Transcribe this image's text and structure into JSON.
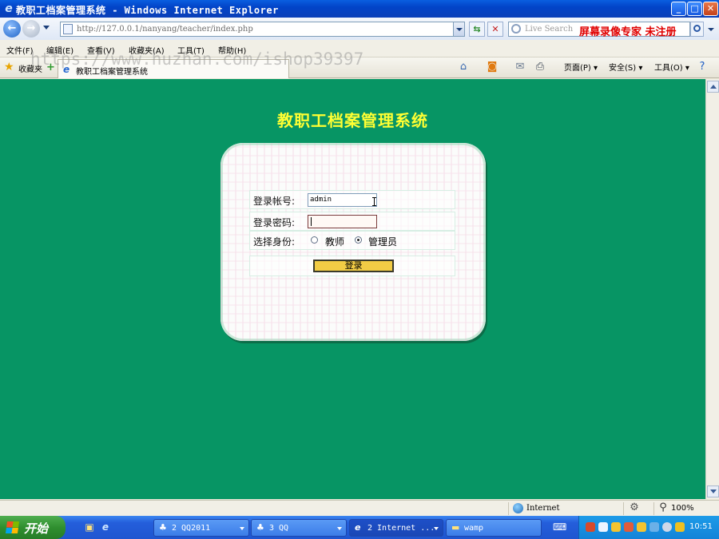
{
  "window": {
    "title": "教职工档案管理系统 - Windows Internet Explorer",
    "minimize": "_",
    "maximize": "□",
    "close": "✕"
  },
  "nav": {
    "back_glyph": "←",
    "forward_glyph": "→",
    "url": "http://127.0.0.1/nanyang/teacher/index.php",
    "refresh_glyph": "⇆",
    "stop_glyph": "✕",
    "search_placeholder": "Live Search",
    "search_overlay": "屏幕录像专家 未注册"
  },
  "menu": [
    "文件(F)",
    "编辑(E)",
    "查看(V)",
    "收藏夹(A)",
    "工具(T)",
    "帮助(H)"
  ],
  "favorites": {
    "label": "收藏夹"
  },
  "tab": {
    "label": "教职工档案管理系统"
  },
  "watermark": "https://www.huzhan.com/ishop39397",
  "toolbar": {
    "page": "页面(P) ▾",
    "safety": "安全(S) ▾",
    "tools": "工具(O) ▾"
  },
  "page": {
    "title": "教职工档案管理系统",
    "username_label": "登录帐号:",
    "username_value": "admin",
    "password_label": "登录密码:",
    "role_label": "选择身份:",
    "role_options": [
      "教师",
      "管理员"
    ],
    "role_selected": "管理员",
    "login_button": "登录"
  },
  "status": {
    "zone": "Internet",
    "zoom": "100%"
  },
  "taskbar": {
    "start": "开始",
    "tasks": [
      "2 QQ2011",
      "3 QQ",
      "2 Internet ...",
      "wamp"
    ],
    "clock": "10:51"
  },
  "colors": {
    "page_bg": "#079564",
    "title_yellow": "#ffff33",
    "login_button": "#f2cc45"
  }
}
